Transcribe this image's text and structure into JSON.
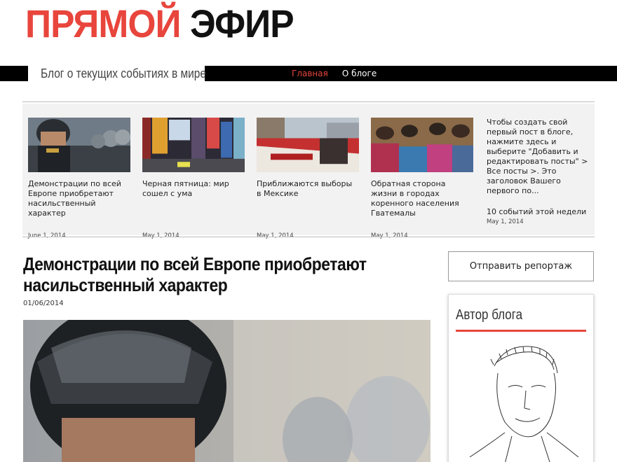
{
  "logo": {
    "part1": "ПРЯМОЙ",
    "part2": "ЭФИР",
    "red": "#e8453c"
  },
  "header": {
    "tagline": "Блог о текущих событиях в мире",
    "nav": [
      {
        "label": "Главная",
        "active": true
      },
      {
        "label": "О блоге",
        "active": false
      }
    ]
  },
  "strip": {
    "cards": [
      {
        "title": "Демонстрации по всей Европе приобретают насильственный характер",
        "date": "June 1, 2014",
        "image": "riot-police-photo"
      },
      {
        "title": "Черная пятница: мир сошел с ума",
        "date": "May 1, 2014",
        "image": "times-square-photo"
      },
      {
        "title": "Приближаются выборы в Мексике",
        "date": "May 1, 2014",
        "image": "mexico-protest-photo"
      },
      {
        "title": "Обратная сторона жизни в городах коренного населения Гватемалы",
        "date": "May 1, 2014",
        "image": "guatemala-women-photo"
      }
    ],
    "promo": {
      "text": "Чтобы создать свой первый пост в блоге, нажмите здесь и выберите \"Добавить и редактировать посты\" > Все посты >. Это заголовок Вашего первого по...",
      "link": "10 событий этой недели",
      "date": "May 1, 2014"
    }
  },
  "article": {
    "title": "Демонстрации по всей Европе приобретают насильственный характер",
    "date": "01/06/2014"
  },
  "sidebar": {
    "report_button": "Отправить репортаж",
    "author_title": "Автор блога"
  }
}
